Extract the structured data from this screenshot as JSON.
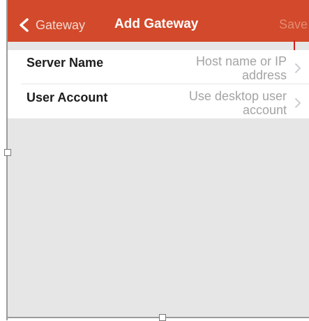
{
  "navbar": {
    "back_label": "Gateway",
    "title": "Add Gateway",
    "save_label": "Save",
    "background": "#d24a2b",
    "back_icon": "chevron-left-icon"
  },
  "form": {
    "rows": [
      {
        "label": "Server Name",
        "value_lines": [
          "Host name or IP",
          "address"
        ],
        "icon": "chevron-right-icon"
      },
      {
        "label": "User Account",
        "value_lines": [
          "Use desktop user",
          "account"
        ],
        "icon": "chevron-right-icon"
      }
    ]
  },
  "colors": {
    "content_background": "#e6e6e6",
    "placeholder_text": "#a4a4a4",
    "save_disabled": "#e58b73",
    "marker": "#d21f1f"
  }
}
